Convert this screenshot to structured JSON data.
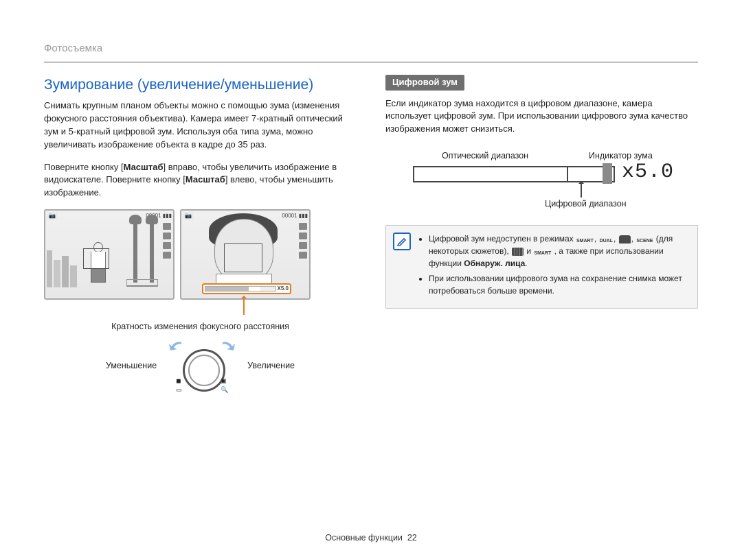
{
  "header": {
    "section": "Фотосъемка"
  },
  "left": {
    "title": "Зумирование (увеличение/уменьшение)",
    "p1": "Снимать крупным планом объекты можно с помощью зума (изменения фокусного расстояния объектива). Камера имеет 7-кратный оптический зум и 5-кратный цифровой зум. Используя оба типа зума, можно увеличивать изображение объекта в кадре до 35 раз.",
    "p2a": "Поверните кнопку [",
    "p2b": "Масштаб",
    "p2c": "] вправо, чтобы увеличить изображение в видоискателе. Поверните кнопку [",
    "p2d": "Масштаб",
    "p2e": "] влево, чтобы уменьшить изображение.",
    "counter": "00001",
    "zoom_on_bar": "X5.0",
    "zoom_desc": "Кратность изменения фокусного расстояния",
    "dial_left": "Уменьшение",
    "dial_right": "Увеличение"
  },
  "right": {
    "badge": "Цифровой зум",
    "p1": "Если индикатор зума находится в цифровом диапазоне, камера использует цифровой зум. При использовании цифрового зума качество изображения может снизиться.",
    "labels": {
      "optical": "Оптический диапазон",
      "indicator": "Индикатор зума",
      "digital": "Цифровой диапазон",
      "value": "x5.0"
    },
    "note_icon": "✎",
    "note1a": "Цифровой зум недоступен в режимах ",
    "note1b": " (для некоторых сюжетов), ",
    "note1c": " и ",
    "note1d": ", а также при использовании функции ",
    "note1e": "Обнаруж. лица",
    "note1f": ".",
    "note2": "При использовании цифрового зума на сохранение снимка может потребоваться больше времени."
  },
  "footer": {
    "label": "Основные функции",
    "page": "22"
  }
}
